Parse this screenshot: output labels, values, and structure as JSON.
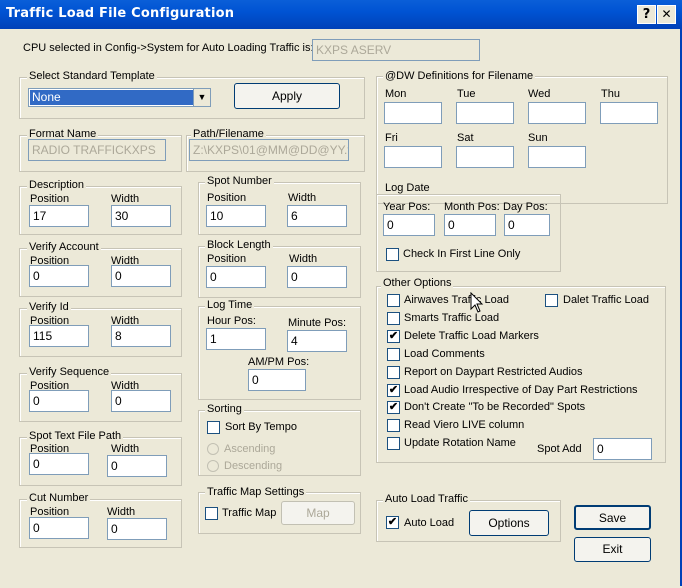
{
  "window": {
    "title": "Traffic Load File Configuration",
    "help": "?",
    "close": "✕"
  },
  "cpu": {
    "label": "CPU selected in Config->System for Auto Loading Traffic is:",
    "value": "KXPS ASERV"
  },
  "template": {
    "title": "Select Standard Template",
    "value": "None",
    "apply": "Apply"
  },
  "format": {
    "title": "Format Name",
    "value": "RADIO TRAFFICKXPS"
  },
  "path": {
    "title": "Path/Filename",
    "value": "Z:\\KXPS\\01@MM@DD@YY.tlf"
  },
  "labels": {
    "position": "Position",
    "width": "Width"
  },
  "description": {
    "title": "Description",
    "position": "17",
    "width": "30"
  },
  "verify_account": {
    "title": "Verify Account",
    "position": "0",
    "width": "0"
  },
  "verify_id": {
    "title": "Verify Id",
    "position": "115",
    "width": "8"
  },
  "verify_sequence": {
    "title": "Verify Sequence",
    "position": "0",
    "width": "0"
  },
  "spot_text": {
    "title": "Spot Text File Path",
    "position": "0",
    "width": "0"
  },
  "cut_number": {
    "title": "Cut Number",
    "position": "0",
    "width": "0"
  },
  "spot_number": {
    "title": "Spot Number",
    "position": "10",
    "width": "6"
  },
  "block_length": {
    "title": "Block Length",
    "position": "0",
    "width": "0"
  },
  "log_time": {
    "title": "Log Time",
    "hour_label": "Hour Pos:",
    "hour": "1",
    "minute_label": "Minute Pos:",
    "minute": "4",
    "ampm_label": "AM/PM Pos:",
    "ampm": "0"
  },
  "sorting": {
    "title": "Sorting",
    "sort_by_tempo": "Sort By Tempo",
    "ascending": "Ascending",
    "descending": "Descending"
  },
  "traffic_map": {
    "title": "Traffic Map Settings",
    "checkbox": "Traffic Map",
    "button": "Map"
  },
  "dw": {
    "title": "@DW Definitions for Filename",
    "days": [
      "Mon",
      "Tue",
      "Wed",
      "Thu",
      "Fri",
      "Sat",
      "Sun"
    ]
  },
  "log_date": {
    "title": "Log Date",
    "year_label": "Year Pos:",
    "year": "0",
    "month_label": "Month Pos:",
    "month": "0",
    "day_label": "Day Pos:",
    "day": "0",
    "check_first_line": "Check In First Line Only"
  },
  "other": {
    "title": "Other Options",
    "items": [
      {
        "label": "Airwaves Traffic Load",
        "checked": false
      },
      {
        "label": "Smarts Traffic Load",
        "checked": false
      },
      {
        "label": "Delete Traffic Load Markers",
        "checked": true
      },
      {
        "label": "Load Comments",
        "checked": false
      },
      {
        "label": "Report on Daypart Restricted Audios",
        "checked": false
      },
      {
        "label": "Load Audio Irrespective of Day Part Restrictions",
        "checked": true
      },
      {
        "label": "Don't Create \"To be Recorded\" Spots",
        "checked": true
      },
      {
        "label": "Read Viero LIVE column",
        "checked": false
      },
      {
        "label": "Update Rotation Name",
        "checked": false
      }
    ],
    "dalet": "Dalet Traffic Load",
    "spot_add_label": "Spot Add",
    "spot_add": "0"
  },
  "auto_load": {
    "title": "Auto Load Traffic",
    "checkbox": "Auto Load",
    "options": "Options"
  },
  "buttons": {
    "save": "Save",
    "exit": "Exit"
  },
  "check_mark": "✔"
}
